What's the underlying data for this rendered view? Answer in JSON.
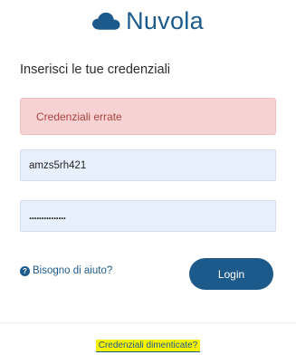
{
  "brand": {
    "name": "Nuvola",
    "icon": "cloud-icon",
    "color": "#1d5a8c"
  },
  "form": {
    "heading": "Inserisci le tue credenziali",
    "error_message": "Credenziali errate",
    "username_value": "amzs5rh421",
    "password_mask": "...............",
    "login_label": "Login"
  },
  "help": {
    "label": "Bisogno di aiuto?",
    "icon": "question-circle-icon"
  },
  "footer": {
    "forgot_label": "Credenziali dimenticate?"
  }
}
